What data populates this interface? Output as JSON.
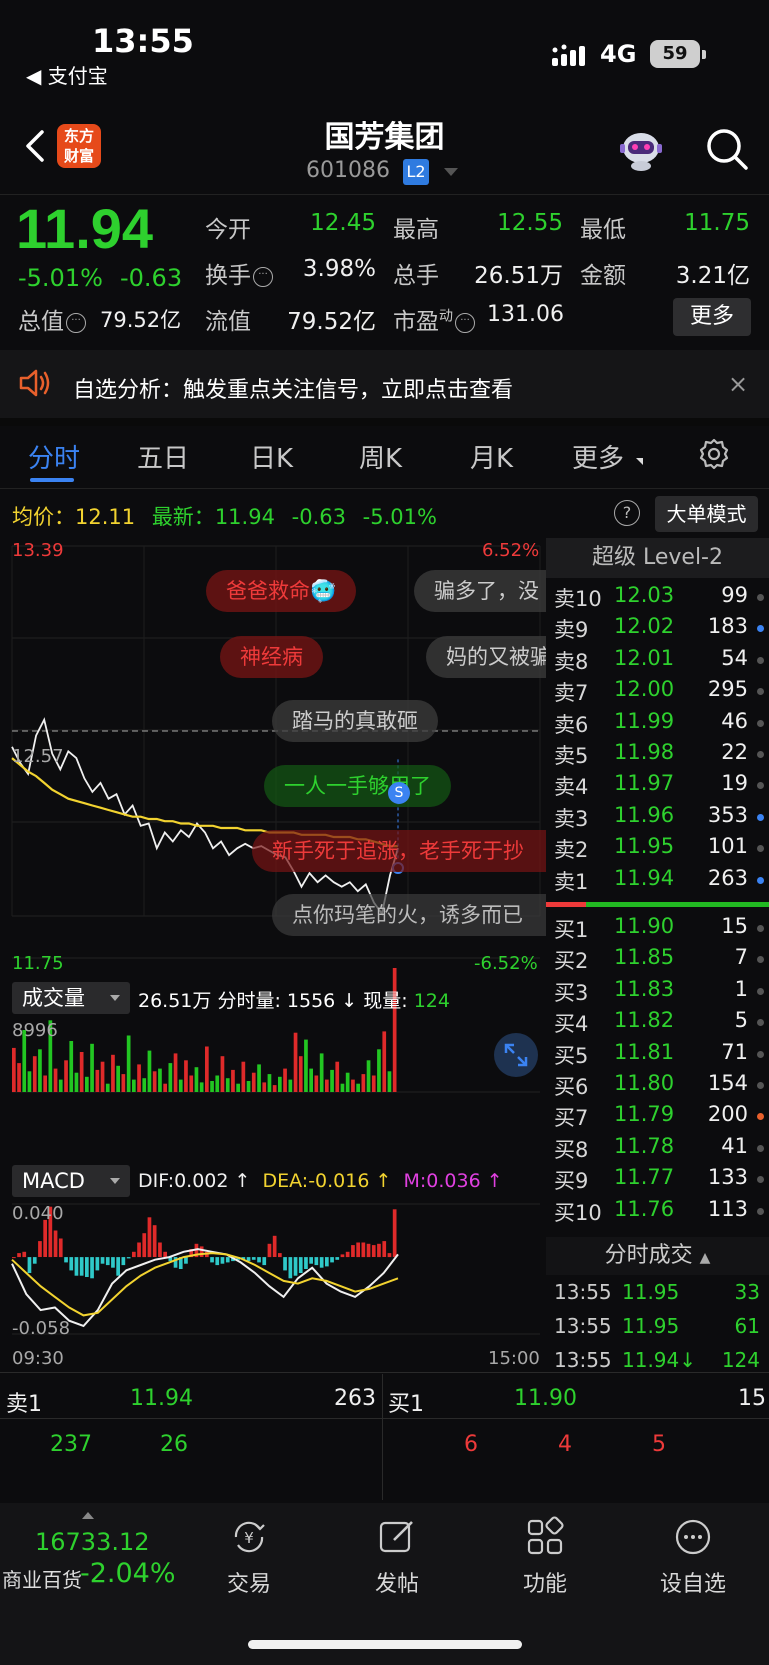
{
  "status_bar": {
    "time": "13:55",
    "back_app": "◀ 支付宝",
    "network": "4G",
    "battery": "59"
  },
  "header": {
    "logo_text": "东方财富",
    "stock_name": "国芳集团",
    "stock_code": "601086",
    "level_badge": "L2"
  },
  "quote": {
    "price": "11.94",
    "change_pct": "-5.01%",
    "change": "-0.63",
    "open_label": "今开",
    "open": "12.45",
    "high_label": "最高",
    "high": "12.55",
    "low_label": "最低",
    "low": "11.75",
    "turnover_label": "换手",
    "turnover": "3.98%",
    "volume_label": "总手",
    "volume": "26.51万",
    "amount_label": "金额",
    "amount": "3.21亿",
    "mktcap_label": "总值",
    "mktcap": "79.52亿",
    "float_label": "流值",
    "float_cap": "79.52亿",
    "pe_label": "市盈",
    "pe_sup": "动",
    "pe": "131.06",
    "more_label": "更多"
  },
  "notice": {
    "text": "自选分析：触发重点关注信号，立即点击查看",
    "close": "×"
  },
  "tabs": [
    {
      "label": "分时",
      "active": true
    },
    {
      "label": "五日"
    },
    {
      "label": "日K"
    },
    {
      "label": "周K"
    },
    {
      "label": "月K"
    },
    {
      "label": "更多"
    }
  ],
  "avg_bar": {
    "avg_label": "均价：",
    "avg": "12.11",
    "last_label": "最新：",
    "last": "11.94",
    "chg": "-0.63",
    "pct": "-5.01%",
    "help": "?",
    "big_mode": "大单模式"
  },
  "bullets": [
    {
      "text": "爸爸救命🥶",
      "style": "red"
    },
    {
      "text": "骗多了，没",
      "style": "grey"
    },
    {
      "text": "神经病",
      "style": "red"
    },
    {
      "text": "妈的又被骗",
      "style": "grey"
    },
    {
      "text": "踏马的真敢砸",
      "style": "grey"
    },
    {
      "text": "一人一手够用了",
      "style": "green"
    },
    {
      "text": "新手死于追涨，老手死于抄",
      "style": "red"
    },
    {
      "text": "点你玛笔的火，诱多而已",
      "style": "grey"
    }
  ],
  "chart_data": [
    {
      "type": "line",
      "title": "分时",
      "ylim": [
        11.75,
        13.39
      ],
      "y_ticks": [
        "13.39",
        "12.57",
        "11.75"
      ],
      "pct_ticks": [
        "6.52%",
        "-6.52%"
      ],
      "prev_close": 12.57,
      "x_labels": [
        "09:30",
        "15:00"
      ],
      "series": [
        {
          "name": "价格",
          "color": "#f0f0f0",
          "values": [
            12.5,
            12.43,
            12.38,
            12.55,
            12.62,
            12.47,
            12.4,
            12.48,
            12.45,
            12.36,
            12.3,
            12.34,
            12.27,
            12.29,
            12.2,
            12.24,
            12.15,
            12.16,
            12.05,
            12.12,
            12.08,
            12.13,
            12.1,
            12.16,
            12.12,
            12.05,
            12.08,
            12.02,
            12.05,
            12.07,
            12.05,
            12.06,
            12.04,
            12.02,
            12.01,
            11.95,
            11.88,
            11.94,
            11.9,
            11.93,
            11.9,
            11.88,
            11.9,
            11.86,
            11.89,
            11.81,
            11.76,
            11.93,
            12.05
          ]
        },
        {
          "name": "均价",
          "color": "#f2d330",
          "values": [
            12.45,
            12.42,
            12.39,
            12.37,
            12.34,
            12.31,
            12.29,
            12.27,
            12.26,
            12.25,
            12.24,
            12.23,
            12.22,
            12.21,
            12.2,
            12.19,
            12.19,
            12.18,
            12.18,
            12.17,
            12.17,
            12.16,
            12.16,
            12.15,
            12.15,
            12.15,
            12.14,
            12.14,
            12.14,
            12.13,
            12.13,
            12.13,
            12.12,
            12.12,
            12.12,
            12.12,
            12.11,
            12.11,
            12.11,
            12.11,
            12.1,
            12.1,
            12.1,
            12.09,
            12.09,
            12.08,
            12.07,
            12.06,
            12.06
          ]
        }
      ]
    },
    {
      "type": "bar",
      "title": "成交量",
      "total": "26.51万",
      "info": "分时量: 1556 ↓ 现量:",
      "current": "124",
      "y_max_label": "8996",
      "ylim": [
        0,
        8996
      ],
      "values": [
        3200,
        2100,
        4500,
        1500,
        2600,
        3100,
        1200,
        5200,
        1700,
        900,
        2300,
        3700,
        1400,
        2900,
        1100,
        3500,
        1600,
        2200,
        600,
        2700,
        1900,
        1300,
        4100,
        900,
        2000,
        1000,
        3000,
        1500,
        1700,
        600,
        2100,
        2800,
        900,
        2300,
        1200,
        1800,
        700,
        3300,
        800,
        1200,
        2600,
        1000,
        1600,
        600,
        2200,
        800,
        1400,
        2000,
        700,
        1300,
        500,
        1100,
        1700,
        900,
        4300,
        2600,
        3800,
        1700,
        1200,
        2800,
        900,
        1600,
        2200,
        600,
        1400,
        900,
        600,
        1300,
        2300,
        1200,
        3100,
        4400,
        1500,
        8996
      ],
      "colors": [
        "r",
        "r",
        "g",
        "g",
        "r",
        "g",
        "r",
        "g",
        "r",
        "g",
        "r",
        "g",
        "g",
        "r",
        "g",
        "g",
        "r",
        "r",
        "g",
        "r",
        "g",
        "r",
        "g",
        "g",
        "r",
        "g",
        "g",
        "r",
        "g",
        "r",
        "g",
        "r",
        "g",
        "r",
        "r",
        "g",
        "g",
        "r",
        "g",
        "g",
        "r",
        "g",
        "r",
        "g",
        "r",
        "g",
        "r",
        "g",
        "r",
        "g",
        "r",
        "g",
        "r",
        "g",
        "r",
        "r",
        "g",
        "g",
        "r",
        "g",
        "r",
        "g",
        "r",
        "g",
        "g",
        "r",
        "g",
        "r",
        "g",
        "r",
        "g",
        "r",
        "g",
        "r"
      ]
    },
    {
      "type": "bar",
      "title": "MACD",
      "dif": "DIF:0.002 ↑",
      "dea": "DEA:-0.016 ↑",
      "m": "M:0.036 ↑",
      "ylim": [
        -0.058,
        0.04
      ],
      "y_ticks": [
        "0.040",
        "-0.058"
      ],
      "values": [
        0.0,
        0.003,
        0.004,
        -0.012,
        -0.005,
        0.012,
        0.028,
        0.038,
        0.02,
        0.014,
        -0.004,
        -0.01,
        -0.014,
        -0.014,
        -0.015,
        -0.016,
        -0.01,
        -0.005,
        -0.006,
        -0.008,
        -0.014,
        -0.006,
        -0.001,
        0.004,
        0.011,
        0.018,
        0.03,
        0.024,
        0.011,
        0.004,
        -0.003,
        -0.008,
        -0.009,
        -0.005,
        0.006,
        0.01,
        0.008,
        0.004,
        -0.004,
        -0.006,
        -0.005,
        -0.004,
        -0.003,
        -0.002,
        -0.002,
        -0.003,
        -0.002,
        -0.004,
        -0.006,
        0.01,
        0.016,
        0.003,
        -0.01,
        -0.016,
        -0.014,
        -0.012,
        -0.009,
        -0.005,
        -0.006,
        -0.008,
        -0.007,
        -0.004,
        -0.002,
        0.002,
        0.004,
        0.009,
        0.011,
        0.011,
        0.01,
        0.009,
        0.01,
        0.012,
        0.003,
        0.036
      ],
      "dif_values": [
        -0.005,
        -0.028,
        -0.04,
        -0.038,
        -0.048,
        -0.052,
        -0.04,
        -0.02,
        -0.01,
        -0.006,
        -0.002,
        0.0,
        0.004,
        0.006,
        0.004,
        0.002,
        -0.004,
        -0.012,
        -0.022,
        -0.03,
        -0.016,
        -0.008,
        -0.02,
        -0.026,
        -0.03,
        -0.022,
        -0.012,
        0.002
      ],
      "dea_values": [
        -0.002,
        -0.012,
        -0.022,
        -0.03,
        -0.038,
        -0.044,
        -0.042,
        -0.032,
        -0.022,
        -0.014,
        -0.008,
        -0.004,
        0.0,
        0.002,
        0.003,
        0.002,
        -0.001,
        -0.006,
        -0.012,
        -0.018,
        -0.02,
        -0.016,
        -0.018,
        -0.022,
        -0.026,
        -0.024,
        -0.02,
        -0.016
      ]
    }
  ],
  "order_book": {
    "title": "超级 Level-2",
    "asks": [
      {
        "label": "卖10",
        "price": "12.03",
        "vol": "99",
        "dot": "#555"
      },
      {
        "label": "卖9",
        "price": "12.02",
        "vol": "183",
        "dot": "#3b83f2"
      },
      {
        "label": "卖8",
        "price": "12.01",
        "vol": "54",
        "dot": "#555"
      },
      {
        "label": "卖7",
        "price": "12.00",
        "vol": "295",
        "dot": "#555"
      },
      {
        "label": "卖6",
        "price": "11.99",
        "vol": "46",
        "dot": "#555"
      },
      {
        "label": "卖5",
        "price": "11.98",
        "vol": "22",
        "dot": "#555"
      },
      {
        "label": "卖4",
        "price": "11.97",
        "vol": "19",
        "dot": "#555"
      },
      {
        "label": "卖3",
        "price": "11.96",
        "vol": "353",
        "dot": "#3b83f2"
      },
      {
        "label": "卖2",
        "price": "11.95",
        "vol": "101",
        "dot": "#555"
      },
      {
        "label": "卖1",
        "price": "11.94",
        "vol": "263",
        "dot": "#3b83f2"
      }
    ],
    "bids": [
      {
        "label": "买1",
        "price": "11.90",
        "vol": "15",
        "dot": "#555"
      },
      {
        "label": "买2",
        "price": "11.85",
        "vol": "7",
        "dot": "#555"
      },
      {
        "label": "买3",
        "price": "11.83",
        "vol": "1",
        "dot": "#555"
      },
      {
        "label": "买4",
        "price": "11.82",
        "vol": "5",
        "dot": "#555"
      },
      {
        "label": "买5",
        "price": "11.81",
        "vol": "71",
        "dot": "#555"
      },
      {
        "label": "买6",
        "price": "11.80",
        "vol": "154",
        "dot": "#555"
      },
      {
        "label": "买7",
        "price": "11.79",
        "vol": "200",
        "dot": "#e8602c"
      },
      {
        "label": "买8",
        "price": "11.78",
        "vol": "41",
        "dot": "#555"
      },
      {
        "label": "买9",
        "price": "11.77",
        "vol": "133",
        "dot": "#555"
      },
      {
        "label": "买10",
        "price": "11.76",
        "vol": "113",
        "dot": "#555"
      }
    ],
    "trades_title": "分时成交",
    "trades": [
      {
        "time": "13:55",
        "price": "11.95",
        "vol": "33"
      },
      {
        "time": "13:55",
        "price": "11.95",
        "vol": "61"
      },
      {
        "time": "13:55",
        "price": "11.94↓",
        "vol": "124"
      }
    ]
  },
  "bid_ask_bar": {
    "ask_label": "卖1",
    "ask_price": "11.94",
    "ask_vol": "263",
    "bid_label": "买1",
    "bid_price": "11.90",
    "bid_vol": "15",
    "ask_queue": [
      "237",
      "26"
    ],
    "bid_queue": [
      "6",
      "4",
      "5"
    ]
  },
  "bottom_nav": {
    "index_value": "16733.12",
    "index_name": "商业百货",
    "index_pct": "-2.04%",
    "items": [
      {
        "label": "交易",
        "icon": "yen-exchange-icon"
      },
      {
        "label": "发帖",
        "icon": "edit-icon"
      },
      {
        "label": "功能",
        "icon": "grid-icon"
      },
      {
        "label": "设自选",
        "icon": "more-circle-icon"
      }
    ]
  },
  "colors": {
    "up": "#ee3a3a",
    "down": "#2ed12e",
    "avg": "#f2d330",
    "accent": "#3b83f2",
    "macd_neg": "#2fc9c9"
  }
}
